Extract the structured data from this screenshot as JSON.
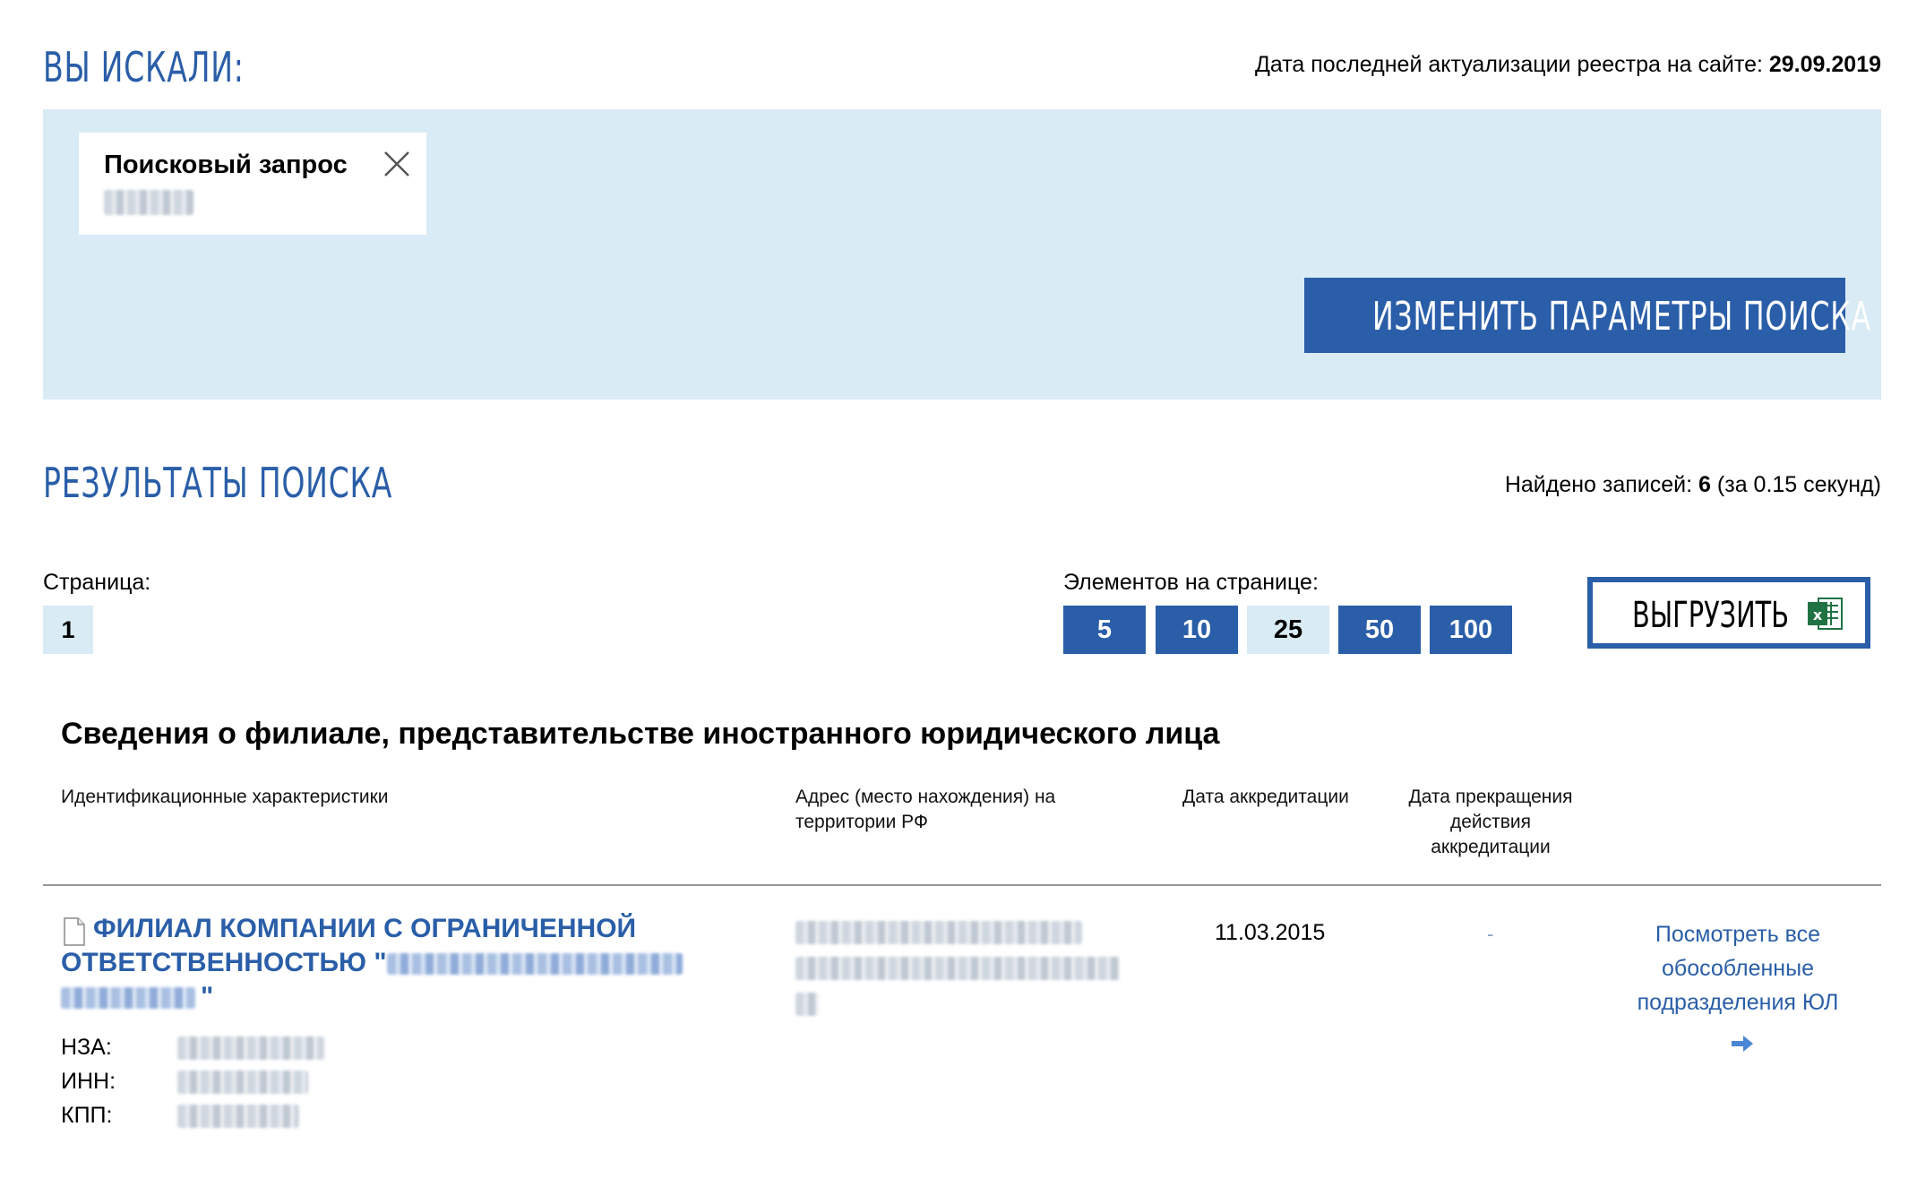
{
  "header": {
    "searched_title": "ВЫ ИСКАЛИ:",
    "update_label": "Дата последней актуализации реестра на сайте:",
    "update_date": "29.09.2019"
  },
  "search_panel": {
    "query_label": "Поисковый запрос",
    "change_button": "ИЗМЕНИТЬ ПАРАМЕТРЫ ПОИСКА"
  },
  "results": {
    "title": "РЕЗУЛЬТАТЫ ПОИСКА",
    "found_label": "Найдено записей:",
    "found_count": "6",
    "found_time": "(за 0.15 секунд)",
    "page_label": "Страница:",
    "current_page": "1",
    "per_page_label": "Элементов на странице:",
    "per_page_options": [
      "5",
      "10",
      "25",
      "50",
      "100"
    ],
    "per_page_selected": "25",
    "export_label": "ВЫГРУЗИТЬ"
  },
  "table": {
    "section_title": "Сведения о филиале, представительстве иностранного юридического лица",
    "headers": {
      "ident": "Идентификационные характеристики",
      "address": "Адрес (место нахождения) на территории РФ",
      "accreditation_date": "Дата аккредитации",
      "termination_date": "Дата прекращения действия аккредитации"
    },
    "rows": [
      {
        "name_prefix": "ФИЛИАЛ КОМПАНИИ С ОГРАНИЧЕННОЙ ОТВЕТСТВЕННОСТЬЮ \"",
        "name_suffix": "\"",
        "nza_label": "НЗА:",
        "inn_label": "ИНН:",
        "kpp_label": "КПП:",
        "accreditation_date": "11.03.2015",
        "termination_date": "-",
        "view_all_label": "Посмотреть все обособленные подразделения ЮЛ"
      }
    ]
  },
  "colors": {
    "accent": "#2a5ea8",
    "panel_bg": "#d9ebf4",
    "excel_green": "#1f7244"
  }
}
